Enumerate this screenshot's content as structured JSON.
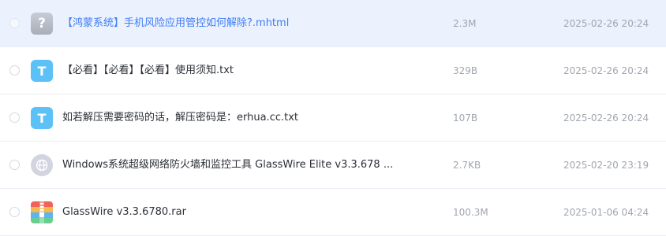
{
  "files": [
    {
      "name": "【鸿蒙系统】手机风险应用管控如何解除?.mhtml",
      "size": "2.3M",
      "date": "2025-02-26 20:24",
      "icon": "unknown-file-icon",
      "glyph": "?"
    },
    {
      "name": "【必看】【必看】【必看】使用须知.txt",
      "size": "329B",
      "date": "2025-02-26 20:24",
      "icon": "text-file-icon",
      "glyph": "T"
    },
    {
      "name": "如若解压需要密码的话，解压密码是：erhua.cc.txt",
      "size": "107B",
      "date": "2025-02-26 20:24",
      "icon": "text-file-icon",
      "glyph": "T"
    },
    {
      "name": "Windows系统超级网络防火墙和监控工具 GlassWire Elite v3.3.678 ...",
      "size": "2.7KB",
      "date": "2025-02-20 23:19",
      "icon": "web-link-icon"
    },
    {
      "name": "GlassWire v3.3.6780.rar",
      "size": "100.3M",
      "date": "2025-01-06 04:24",
      "icon": "archive-file-icon"
    }
  ]
}
